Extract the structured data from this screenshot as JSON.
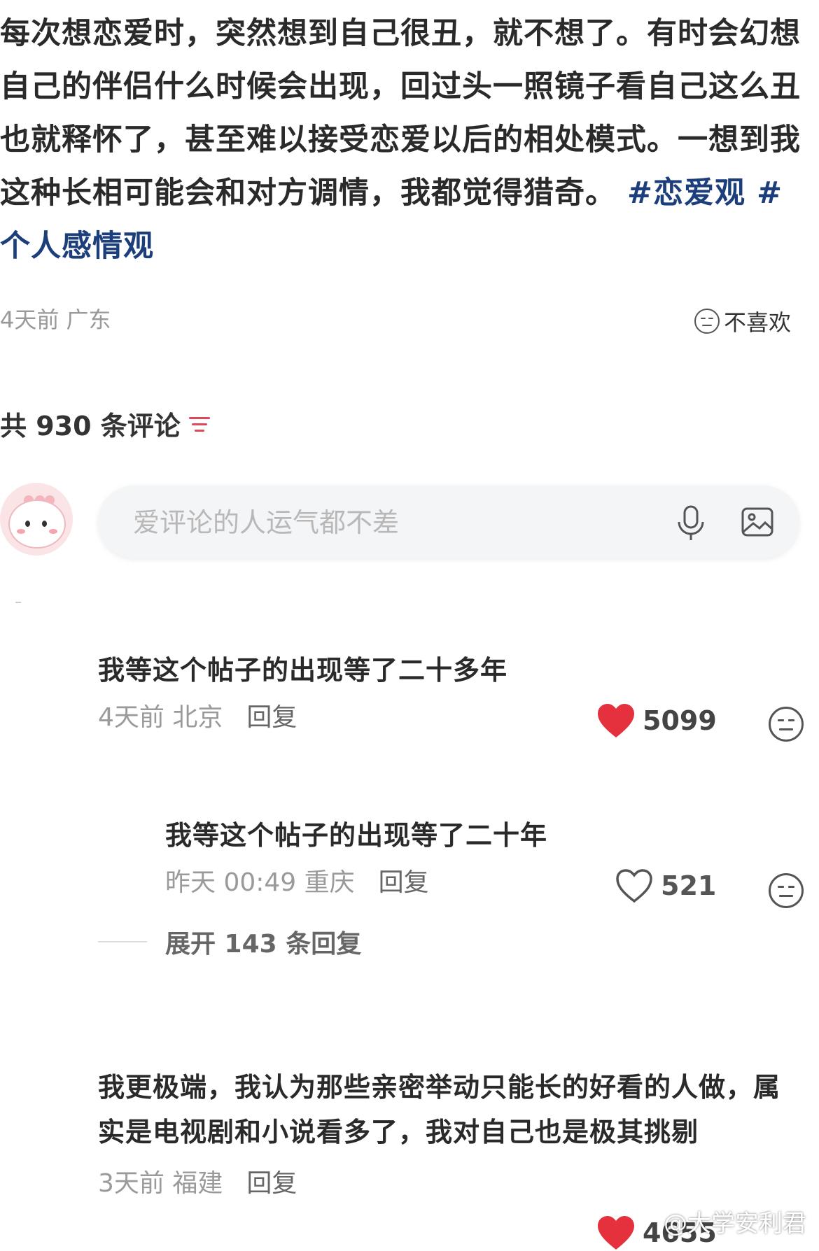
{
  "post": {
    "text": "每次想恋爱时，突然想到自己很丑，就不想了。有时会幻想自己的伴侣什么时候会出现，回过头一照镜子看自己这么丑也就释怀了，甚至难以接受恋爱以后的相处模式。一想到我这种长相可能会和对方调情，我都觉得猎奇。",
    "tag1": "#恋爱观",
    "tag2": "#个人感情观",
    "meta": "4天前 广东",
    "dislike_label": "不喜欢"
  },
  "comments_header": {
    "count_label": "共 930 条评论",
    "sort_icon": "sort-icon"
  },
  "composer": {
    "placeholder": "爱评论的人运气都不差",
    "mic_icon": "microphone-icon",
    "image_icon": "image-icon"
  },
  "comments": [
    {
      "text": "我等这个帖子的出现等了二十多年",
      "time_loc": "4天前 北京",
      "reply": "回复",
      "likes": "5099",
      "liked": true
    },
    {
      "text": "我等这个帖子的出现等了二十年",
      "time_loc": "昨天 00:49 重庆",
      "reply": "回复",
      "likes": "521",
      "liked": false
    },
    {
      "text": "我更极端，我认为那些亲密举动只能长的好看的人做，属实是电视剧和小说看多了，我对自己也是极其挑剔",
      "time_loc": "3天前 福建",
      "reply": "回复",
      "likes": "4655",
      "liked": true
    }
  ],
  "expand_label": "展开 143 条回复",
  "watermark": "@大学安利君",
  "colors": {
    "accent": "#e5313d",
    "tag": "#1c3f7c",
    "muted": "#999999"
  }
}
